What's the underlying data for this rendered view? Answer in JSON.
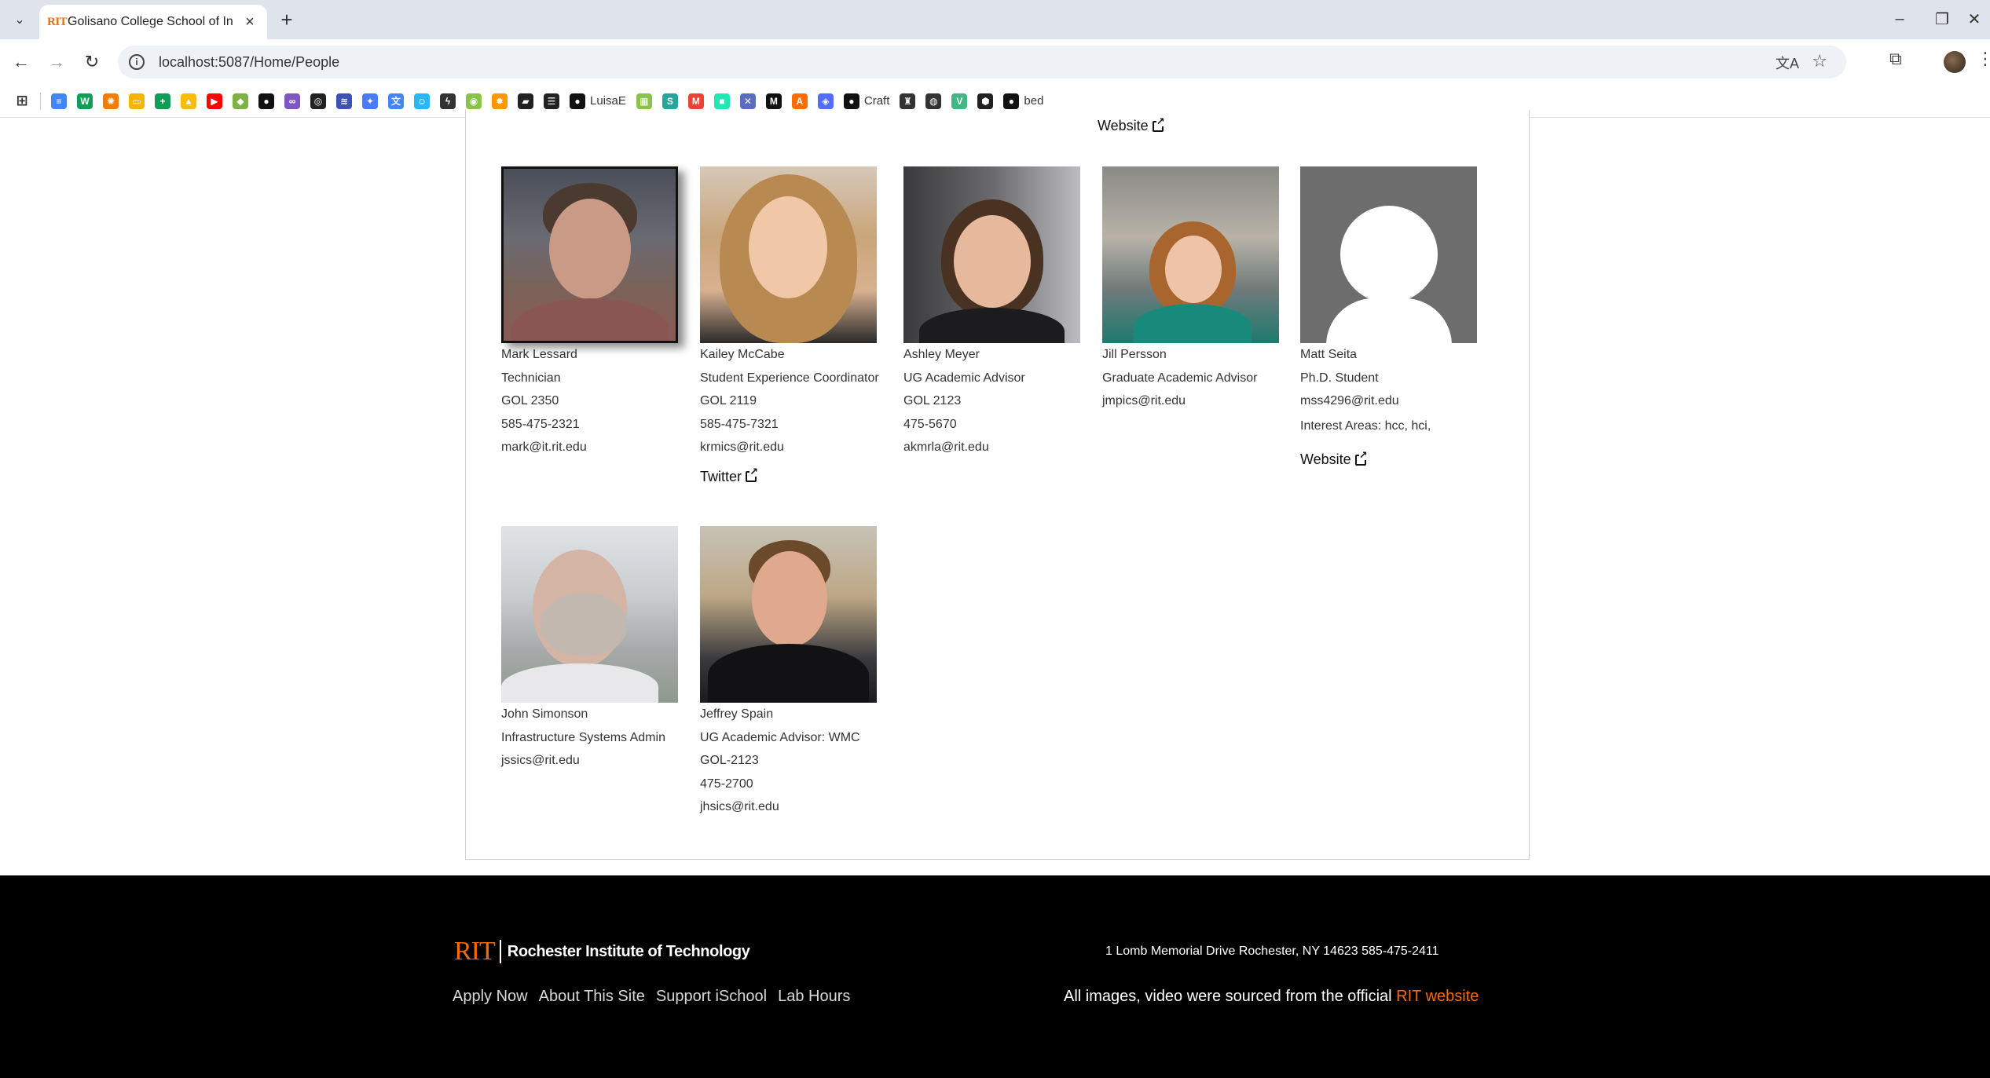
{
  "browser": {
    "tab_title": "Golisano College School of Information",
    "tab_favicon": "RIT",
    "url": "localhost:5087/Home/People",
    "bookmarks": [
      {
        "icon": "docs-icon",
        "color": "#4285f4",
        "glyph": "≡",
        "label": ""
      },
      {
        "icon": "sheets-icon",
        "color": "#0f9d58",
        "glyph": "W",
        "label": ""
      },
      {
        "icon": "orange-sun-icon",
        "color": "#f57c00",
        "glyph": "✺",
        "label": ""
      },
      {
        "icon": "slides-icon",
        "color": "#f4b400",
        "glyph": "▭",
        "label": ""
      },
      {
        "icon": "plus-sheet-icon",
        "color": "#0f9d58",
        "glyph": "+",
        "label": ""
      },
      {
        "icon": "drive-icon",
        "color": "#fbbc04",
        "glyph": "▲",
        "label": ""
      },
      {
        "icon": "youtube-icon",
        "color": "#ff0000",
        "glyph": "▶",
        "label": ""
      },
      {
        "icon": "android-icon",
        "color": "#7cb342",
        "glyph": "◆",
        "label": ""
      },
      {
        "icon": "github-icon",
        "color": "#111111",
        "glyph": "●",
        "label": ""
      },
      {
        "icon": "purple-loop-icon",
        "color": "#7e57c2",
        "glyph": "∞",
        "label": ""
      },
      {
        "icon": "openai-icon",
        "color": "#222222",
        "glyph": "◎",
        "label": ""
      },
      {
        "icon": "blue-wave-icon",
        "color": "#3f51b5",
        "glyph": "≋",
        "label": ""
      },
      {
        "icon": "gemini-icon",
        "color": "#4a7bf7",
        "glyph": "✦",
        "label": ""
      },
      {
        "icon": "translate-bm-icon",
        "color": "#4285f4",
        "glyph": "文",
        "label": ""
      },
      {
        "icon": "robot-icon",
        "color": "#29b6f6",
        "glyph": "☺",
        "label": ""
      },
      {
        "icon": "bolt-icon",
        "color": "#333333",
        "glyph": "ϟ",
        "label": ""
      },
      {
        "icon": "green-ring-icon",
        "color": "#8bc34a",
        "glyph": "◉",
        "label": ""
      },
      {
        "icon": "orange-gear-icon",
        "color": "#ff9800",
        "glyph": "✹",
        "label": ""
      },
      {
        "icon": "notebook-icon",
        "color": "#222222",
        "glyph": "▰",
        "label": ""
      },
      {
        "icon": "stack-icon",
        "color": "#222222",
        "glyph": "☰",
        "label": ""
      },
      {
        "icon": "github-luisae-icon",
        "color": "#111111",
        "glyph": "●",
        "label": "LuisaE"
      },
      {
        "icon": "image-icon",
        "color": "#8bc34a",
        "glyph": "▦",
        "label": ""
      },
      {
        "icon": "green-swirl-icon",
        "color": "#26a69a",
        "glyph": "S",
        "label": ""
      },
      {
        "icon": "gmail-icon",
        "color": "#ea4335",
        "glyph": "M",
        "label": ""
      },
      {
        "icon": "teal-square-icon",
        "color": "#1de9b6",
        "glyph": "■",
        "label": ""
      },
      {
        "icon": "tools-icon",
        "color": "#5c6bc0",
        "glyph": "✕",
        "label": ""
      },
      {
        "icon": "medium-icon",
        "color": "#111111",
        "glyph": "M",
        "label": ""
      },
      {
        "icon": "api-icon",
        "color": "#ff6d00",
        "glyph": "A",
        "label": ""
      },
      {
        "icon": "shield-bm-icon",
        "color": "#536dfe",
        "glyph": "◈",
        "label": ""
      },
      {
        "icon": "github-craft-icon",
        "color": "#111111",
        "glyph": "●",
        "label": "Craft"
      },
      {
        "icon": "crest-icon",
        "color": "#333333",
        "glyph": "♜",
        "label": ""
      },
      {
        "icon": "globe-icon",
        "color": "#333333",
        "glyph": "◍",
        "label": ""
      },
      {
        "icon": "vue-icon",
        "color": "#41b883",
        "glyph": "V",
        "label": ""
      },
      {
        "icon": "cube-icon",
        "color": "#222222",
        "glyph": "⬢",
        "label": ""
      },
      {
        "icon": "github-bed-icon",
        "color": "#111111",
        "glyph": "●",
        "label": "bed"
      }
    ]
  },
  "top_website_label": "Website",
  "people": [
    {
      "name": "Mark Lessard",
      "title": "Technician",
      "room": "GOL 2350",
      "phone": "585-475-2321",
      "email": "mark@it.rit.edu"
    },
    {
      "name": "Kailey McCabe",
      "title": "Student Experience Coordinator",
      "room": "GOL 2119",
      "phone": "585-475-7321",
      "email": "krmics@rit.edu",
      "social": "Twitter"
    },
    {
      "name": "Ashley Meyer",
      "title": "UG Academic Advisor",
      "room": "GOL 2123",
      "phone": "475-5670",
      "email": "akmrla@rit.edu"
    },
    {
      "name": "Jill Persson",
      "title": "Graduate Academic Advisor",
      "email": "jmpics@rit.edu"
    },
    {
      "name": "Matt Seita",
      "title": "Ph.D. Student",
      "email": "mss4296@rit.edu",
      "interests": "Interest Areas: hcc, hci,",
      "website": "Website"
    },
    {
      "name": "John Simonson",
      "title": "Infrastructure Systems Admin",
      "email": "jssics@rit.edu"
    },
    {
      "name": "Jeffrey Spain",
      "title": "UG Academic Advisor: WMC",
      "room": "GOL-2123",
      "phone": "475-2700",
      "email": "jhsics@rit.edu"
    }
  ],
  "footer": {
    "logo_mark": "RIT",
    "logo_name": "Rochester Institute of Technology",
    "links": [
      "Apply Now",
      "About This Site",
      "Support iSchool",
      "Lab Hours"
    ],
    "address": "1 Lomb Memorial Drive Rochester, NY 14623 585-475-2411",
    "credit_text": "All images, video were sourced from the official ",
    "credit_link": "RIT website",
    "accent_color": "#f76902"
  }
}
